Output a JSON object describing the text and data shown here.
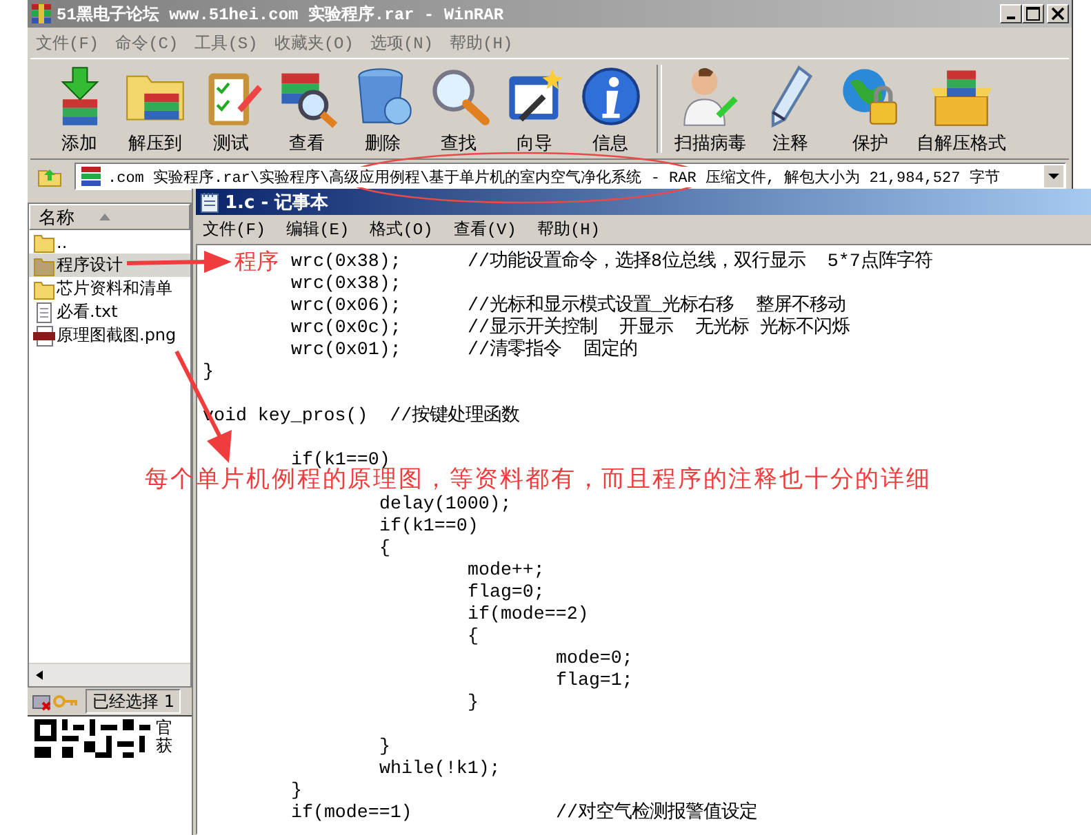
{
  "winrar": {
    "title": "51黑电子论坛 www.51hei.com 实验程序.rar - WinRAR",
    "menu": [
      "文件(F)",
      "命令(C)",
      "工具(S)",
      "收藏夹(O)",
      "选项(N)",
      "帮助(H)"
    ],
    "toolbar": [
      {
        "label": "添加",
        "kind": "add",
        "separator_before": false
      },
      {
        "label": "解压到",
        "kind": "extract",
        "separator_before": false
      },
      {
        "label": "测试",
        "kind": "test",
        "separator_before": false
      },
      {
        "label": "查看",
        "kind": "view",
        "separator_before": false
      },
      {
        "label": "删除",
        "kind": "delete",
        "separator_before": false
      },
      {
        "label": "查找",
        "kind": "find",
        "separator_before": false
      },
      {
        "label": "向导",
        "kind": "wizard",
        "separator_before": false
      },
      {
        "label": "信息",
        "kind": "info",
        "separator_before": false
      },
      {
        "label": "扫描病毒",
        "kind": "scan",
        "separator_before": true
      },
      {
        "label": "注释",
        "kind": "comment",
        "separator_before": false
      },
      {
        "label": "保护",
        "kind": "protect",
        "separator_before": false
      },
      {
        "label": "自解压格式",
        "kind": "sfx",
        "separator_before": false
      }
    ],
    "address": {
      "text": ".com 实验程序.rar\\实验程序\\高级应用例程\\基于单片机的室内空气净化系统 - RAR 压缩文件, 解包大小为 21,984,527 字节"
    },
    "file_list": {
      "header": {
        "label": "名称",
        "sorted": true
      },
      "items": [
        {
          "name": "..",
          "kind": "folder",
          "selected": false
        },
        {
          "name": "程序设计",
          "kind": "folder",
          "selected": true
        },
        {
          "name": "芯片资料和清单",
          "kind": "folder",
          "selected": false
        },
        {
          "name": "必看.txt",
          "kind": "text",
          "selected": false
        },
        {
          "name": "原理图截图.png",
          "kind": "image",
          "selected": false
        }
      ]
    },
    "status_bar": {
      "text": "已经选择 1"
    }
  },
  "qr_caption": [
    "官",
    "获"
  ],
  "notepad": {
    "title": "1.c - 记事本",
    "menu": [
      "文件(F)",
      "编辑(E)",
      "格式(O)",
      "查看(V)",
      "帮助(H)"
    ],
    "code": "\twrc(0x38);\t//功能设置命令，选择8位总线，双行显示  5*7点阵字符\n\twrc(0x38);\n\twrc(0x06);\t//光标和显示模式设置_光标右移  整屏不移动\n\twrc(0x0c);\t//显示开关控制  开显示  无光标 光标不闪烁\n\twrc(0x01);\t//清零指令  固定的\n}\n\nvoid key_pros()  //按键处理函数\n\n\tif(k1==0)\n\n\t\tdelay(1000);\n\t\tif(k1==0)\n\t\t{\n\t\t\tmode++;\n\t\t\tflag=0;\n\t\t\tif(mode==2)\n\t\t\t{\n\t\t\t\tmode=0;\n\t\t\t\tflag=1;\n\t\t\t}\n\n\t\t}\n\t\twhile(!k1);\n\t}\n\tif(mode==1)\t\t//对空气检测报警值设定"
  },
  "annotations": [
    {
      "text": "程序"
    },
    {
      "text": "每个单片机例程的原理图，等资料都有，而且程序的注释也十分的详细"
    }
  ]
}
